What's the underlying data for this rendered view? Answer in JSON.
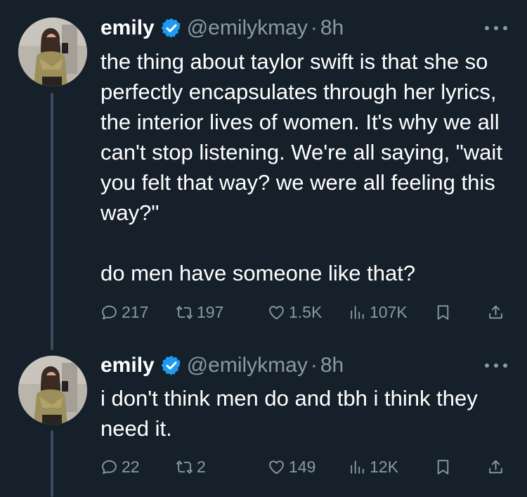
{
  "tweets": [
    {
      "author": {
        "name": "emily",
        "handle": "@emilykmay",
        "verified": true
      },
      "separator": "·",
      "time": "8h",
      "paragraphs": [
        "the thing about taylor swift is that she so perfectly encapsulates through her lyrics, the interior lives of women. It's why we all can't stop listening. We're all saying, \"wait you felt that way? we were all feeling this way?\"",
        "do men have someone like that?"
      ],
      "stats": {
        "replies": "217",
        "reposts": "197",
        "likes": "1.5K",
        "views": "107K"
      }
    },
    {
      "author": {
        "name": "emily",
        "handle": "@emilykmay",
        "verified": true
      },
      "separator": "·",
      "time": "8h",
      "paragraphs": [
        "i don't think men do and tbh i think they need it."
      ],
      "stats": {
        "replies": "22",
        "reposts": "2",
        "likes": "149",
        "views": "12K"
      }
    }
  ],
  "icons": {
    "verified": "verified-badge-icon",
    "more": "more-dots-icon",
    "reply": "reply-bubble-icon",
    "repost": "repost-arrows-icon",
    "like": "heart-icon",
    "views": "views-bar-chart-icon",
    "bookmark": "bookmark-icon",
    "share": "share-icon"
  },
  "colors": {
    "background": "#15202b",
    "text": "#ffffff",
    "secondary": "#8b98a5",
    "verified": "#1d9bf0",
    "thread_line": "#384a5c"
  }
}
